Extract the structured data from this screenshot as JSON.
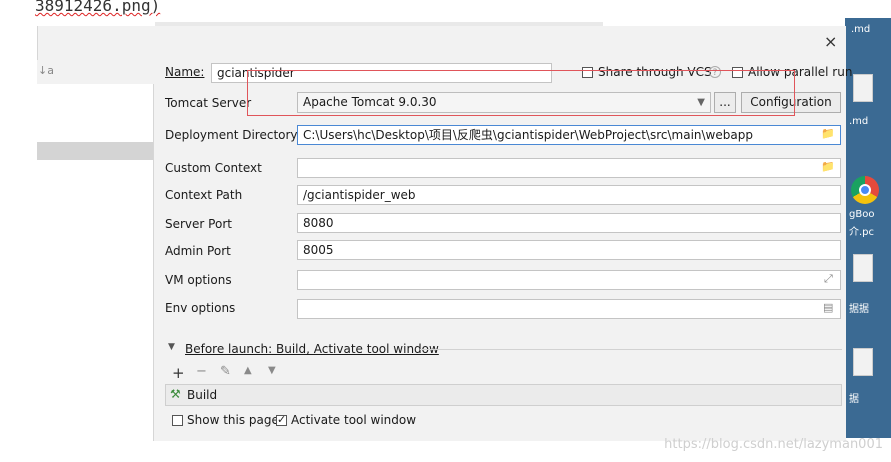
{
  "background": {
    "filename_text": "38912426.png)",
    "desktop_items": [
      ".md",
      ".md",
      "gBoo",
      "介.pc",
      "据据",
      "据"
    ],
    "watermark": "https://blog.csdn.net/lazyman001"
  },
  "dialog": {
    "close_label": "×",
    "name_label": "Name:",
    "name_value": "gciantispider",
    "share_vcs_label": "Share through VCS",
    "help_label": "?",
    "allow_parallel_label": "Allow parallel run",
    "tomcat_server_label": "Tomcat Server",
    "tomcat_server_value": "Apache Tomcat 9.0.30",
    "browse_label": "...",
    "configuration_label": "Configuration",
    "deployment_dir_label": "Deployment Directory",
    "deployment_dir_value": "C:\\Users\\hc\\Desktop\\项目\\反爬虫\\gciantispider\\WebProject\\src\\main\\webapp",
    "custom_context_label": "Custom Context",
    "custom_context_value": "",
    "context_path_label": "Context Path",
    "context_path_value": "/gciantispider_web",
    "server_port_label": "Server Port",
    "server_port_value": "8080",
    "admin_port_label": "Admin Port",
    "admin_port_value": "8005",
    "vm_options_label": "VM options",
    "vm_options_value": "",
    "env_options_label": "Env options",
    "env_options_value": "",
    "before_launch_label": "Before launch: Build, Activate tool window",
    "build_task_label": "Build",
    "show_page_label": "Show this page",
    "activate_tool_label": "Activate tool window"
  },
  "colors": {
    "accent_focus": "#4a88d4",
    "highlight_box": "#e0555a"
  }
}
